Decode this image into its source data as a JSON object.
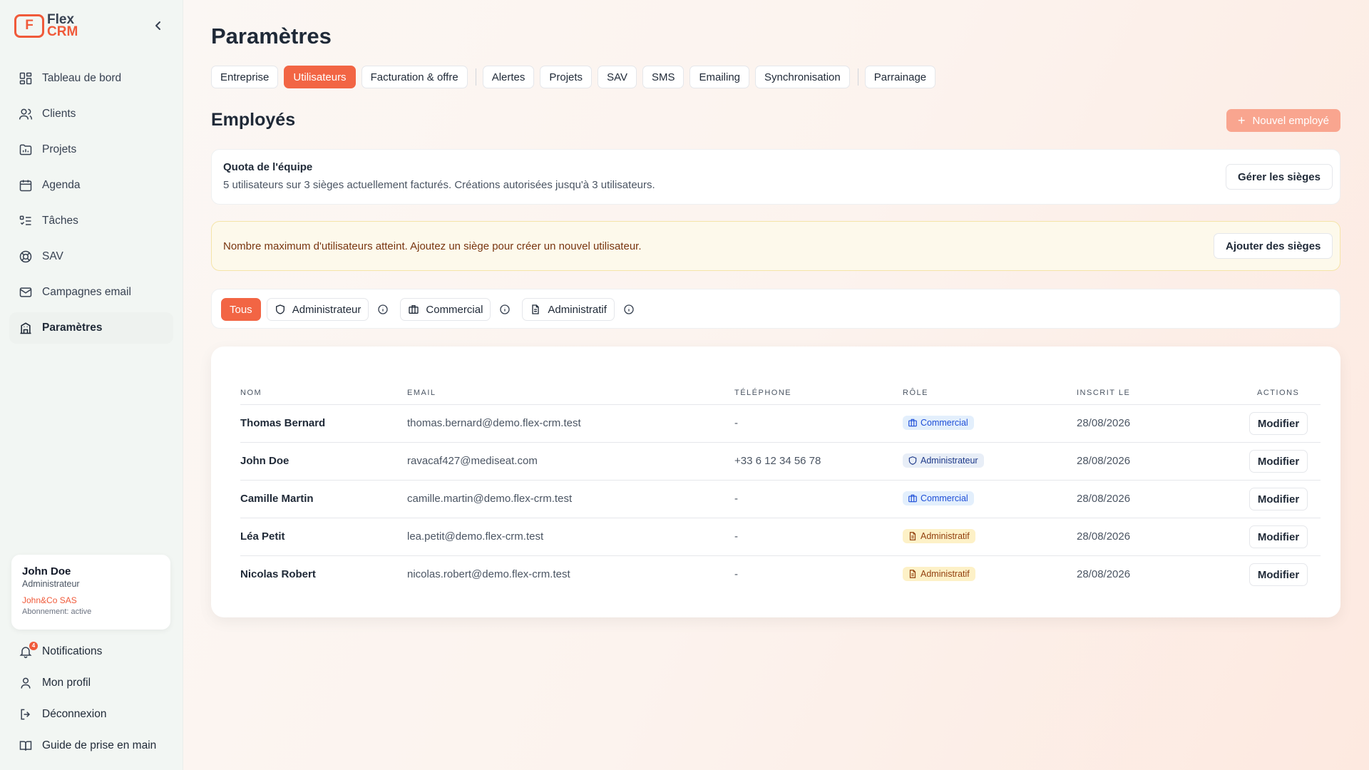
{
  "logo": {
    "line1": "Flex",
    "line2": "CRM",
    "mark": "F"
  },
  "sidebar": {
    "collapse_icon": "chevron-left-icon",
    "items": [
      {
        "label": "Tableau de bord",
        "icon": "dashboard-icon"
      },
      {
        "label": "Clients",
        "icon": "users-icon"
      },
      {
        "label": "Projets",
        "icon": "folder-chart-icon"
      },
      {
        "label": "Agenda",
        "icon": "calendar-icon"
      },
      {
        "label": "Tâches",
        "icon": "tasks-icon"
      },
      {
        "label": "SAV",
        "icon": "lifebuoy-icon"
      },
      {
        "label": "Campagnes email",
        "icon": "mail-icon"
      },
      {
        "label": "Paramètres",
        "icon": "settings-building-icon",
        "active": true
      }
    ],
    "user": {
      "name": "John Doe",
      "role": "Administrateur",
      "company": "John&Co SAS",
      "subscription": "Abonnement: active"
    },
    "bottom": {
      "notifications": "Notifications",
      "notifications_count": "4",
      "profile": "Mon profil",
      "logout": "Déconnexion",
      "guide": "Guide de prise en main"
    }
  },
  "page": {
    "title": "Paramètres",
    "tabs": [
      "Entreprise",
      "Utilisateurs",
      "Facturation & offre",
      "Alertes",
      "Projets",
      "SAV",
      "SMS",
      "Emailing",
      "Synchronisation",
      "Parrainage"
    ],
    "active_tab": "Utilisateurs",
    "section_title": "Employés",
    "new_button": "Nouvel employé",
    "quota": {
      "title": "Quota de l'équipe",
      "text": "5 utilisateurs sur 3 sièges actuellement facturés. Créations autorisées jusqu'à 3 utilisateurs.",
      "button": "Gérer les sièges"
    },
    "warning": {
      "text": "Nombre maximum d'utilisateurs atteint. Ajoutez un siège pour créer un nouvel utilisateur.",
      "button": "Ajouter des sièges"
    },
    "filters": {
      "all": "Tous",
      "admin": "Administrateur",
      "commercial": "Commercial",
      "administratif": "Administratif"
    }
  },
  "table": {
    "headers": {
      "name": "NOM",
      "email": "EMAIL",
      "phone": "TÉLÉPHONE",
      "role": "RÔLE",
      "date": "INSCRIT LE",
      "actions": "ACTIONS"
    },
    "modify_label": "Modifier",
    "rows": [
      {
        "name": "Thomas Bernard",
        "email": "thomas.bernard@demo.flex-crm.test",
        "phone": "-",
        "role": "Commercial",
        "date": "28/08/2026"
      },
      {
        "name": "John Doe",
        "email": "ravacaf427@mediseat.com",
        "phone": "+33 6 12 34 56 78",
        "role": "Administrateur",
        "date": "28/08/2026"
      },
      {
        "name": "Camille Martin",
        "email": "camille.martin@demo.flex-crm.test",
        "phone": "-",
        "role": "Commercial",
        "date": "28/08/2026"
      },
      {
        "name": "Léa Petit",
        "email": "lea.petit@demo.flex-crm.test",
        "phone": "-",
        "role": "Administratif",
        "date": "28/08/2026"
      },
      {
        "name": "Nicolas Robert",
        "email": "nicolas.robert@demo.flex-crm.test",
        "phone": "-",
        "role": "Administratif",
        "date": "28/08/2026"
      }
    ]
  },
  "colors": {
    "accent": "#f26544",
    "accent_light": "#f9a58f",
    "sidebar_bg": "#f2f6f3",
    "warning_bg": "#fdf9eb",
    "commercial_badge": "#e3effc",
    "admin_badge": "#e8eef7",
    "administratif_badge": "#fdf1c7"
  }
}
